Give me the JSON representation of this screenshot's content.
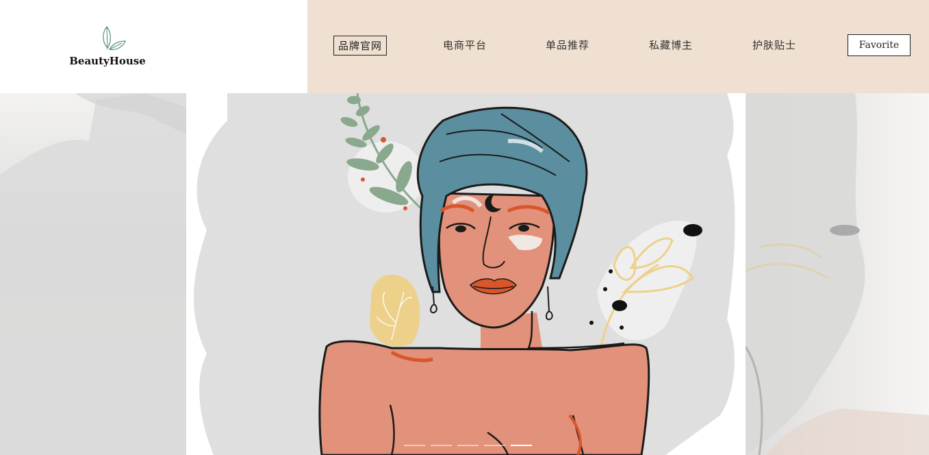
{
  "brand": {
    "name": "BeautyHouse",
    "icon": "leaf-icon"
  },
  "nav": {
    "items": [
      {
        "label": "品牌官网",
        "active": true
      },
      {
        "label": "电商平台"
      },
      {
        "label": "单品推荐"
      },
      {
        "label": "私藏博主"
      },
      {
        "label": "护肤贴士"
      }
    ],
    "favorite_label": "Favorite"
  },
  "carousel": {
    "slide_count": 5,
    "active_index": 4
  },
  "colors": {
    "nav_bg": "#efe0d1",
    "turban": "#5b8fa0",
    "skin": "#e2917a",
    "accent_orange": "#d9552a",
    "leaf_green": "#8aa88d",
    "yellow": "#edd18a"
  }
}
